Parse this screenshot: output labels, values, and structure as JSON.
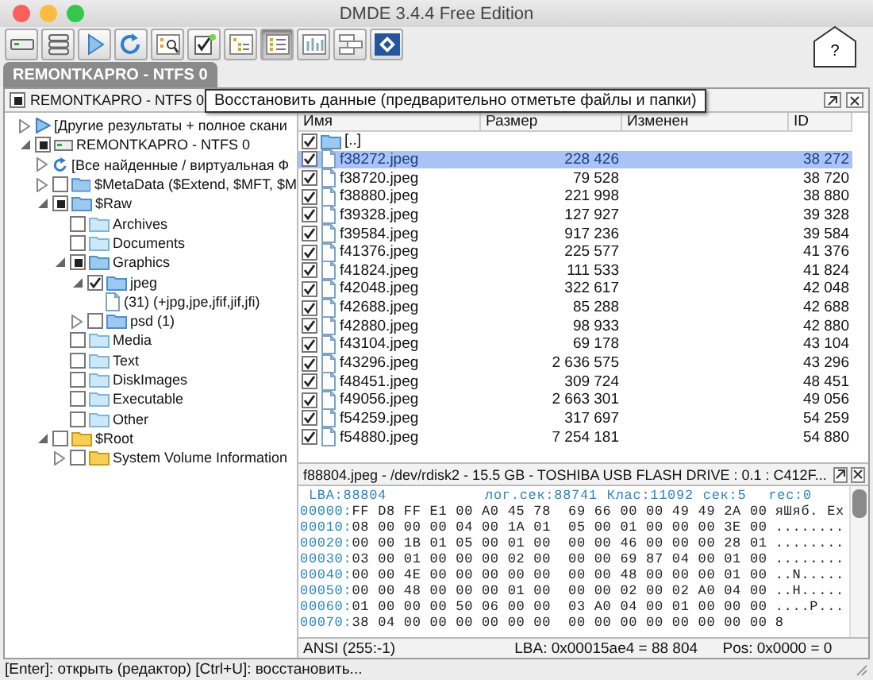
{
  "window": {
    "title": "DMDE 3.4.4 Free Edition"
  },
  "toolbar": [
    {
      "selected": false
    },
    {
      "selected": false
    },
    {
      "selected": false
    },
    {
      "selected": false
    },
    {
      "selected": false
    },
    {
      "selected": false
    },
    {
      "selected": false
    },
    {
      "selected": true
    },
    {
      "selected": false
    },
    {
      "selected": false
    },
    {
      "selected": false
    }
  ],
  "help_button": "?",
  "tabs": [
    {
      "label": "REMONTKAPRO - NTFS 0",
      "selected": true
    }
  ],
  "panel": {
    "title": "REMONTKAPRO - NTFS 0",
    "tooltip": "Восстановить данные (предварительно отметьте файлы и папки)"
  },
  "tree": [
    {
      "label": "[Другие результаты + полное скани",
      "kind": "play",
      "expanded": false
    },
    {
      "label": "REMONTKAPRO - NTFS 0",
      "kind": "drive",
      "expanded": true,
      "checked": false,
      "partial": true,
      "children": [
        {
          "label": "[Все найденные / виртуальная Ф",
          "kind": "refresh",
          "expanded": false
        },
        {
          "label": "$MetaData ($Extend, $MFT, $M",
          "kind": "folder",
          "expanded": false,
          "checked": false,
          "partial": false
        },
        {
          "label": "$Raw",
          "kind": "folder",
          "expanded": true,
          "checked": false,
          "partial": true,
          "children": [
            {
              "label": "Archives",
              "kind": "folder-light",
              "checked": false,
              "partial": false
            },
            {
              "label": "Documents",
              "kind": "folder-light",
              "checked": false,
              "partial": false
            },
            {
              "label": "Graphics",
              "kind": "folder",
              "expanded": true,
              "checked": false,
              "partial": true,
              "children": [
                {
                  "label": "jpeg",
                  "kind": "folder",
                  "expanded": true,
                  "checked": true,
                  "partial": false,
                  "children": [
                    {
                      "label": "(31) (+jpg,jpe,jfif,jif,jfi)",
                      "kind": "file"
                    }
                  ]
                },
                {
                  "label": "psd (1)",
                  "kind": "folder",
                  "expanded": false,
                  "checked": false,
                  "partial": false
                }
              ]
            },
            {
              "label": "Media",
              "kind": "folder-light",
              "checked": false,
              "partial": false
            },
            {
              "label": "Text",
              "kind": "folder-light",
              "checked": false,
              "partial": false
            },
            {
              "label": "DiskImages",
              "kind": "folder-light",
              "checked": false,
              "partial": false
            },
            {
              "label": "Executable",
              "kind": "folder-light",
              "checked": false,
              "partial": false
            },
            {
              "label": "Other",
              "kind": "folder-light",
              "checked": false,
              "partial": false
            }
          ]
        },
        {
          "label": "$Root",
          "kind": "folder-yellow",
          "expanded": true,
          "checked": false,
          "partial": false,
          "children": [
            {
              "label": "System Volume Information",
              "kind": "folder-yellow",
              "expanded": false,
              "checked": false,
              "partial": false
            }
          ]
        }
      ]
    }
  ],
  "table": {
    "columns": [
      "Имя",
      "Размер",
      "Изменен",
      "ID"
    ],
    "rows": [
      {
        "name": "[..]",
        "kind": "folder",
        "checked": true,
        "selected": false
      },
      {
        "name": "f38272.jpeg",
        "size": "228 426",
        "id": "38 272",
        "kind": "file",
        "checked": true,
        "selected": true
      },
      {
        "name": "f38720.jpeg",
        "size": "79 528",
        "id": "38 720",
        "kind": "file",
        "checked": true,
        "selected": false
      },
      {
        "name": "f38880.jpeg",
        "size": "221 998",
        "id": "38 880",
        "kind": "file",
        "checked": true,
        "selected": false
      },
      {
        "name": "f39328.jpeg",
        "size": "127 927",
        "id": "39 328",
        "kind": "file",
        "checked": true,
        "selected": false
      },
      {
        "name": "f39584.jpeg",
        "size": "917 236",
        "id": "39 584",
        "kind": "file",
        "checked": true,
        "selected": false
      },
      {
        "name": "f41376.jpeg",
        "size": "225 577",
        "id": "41 376",
        "kind": "file",
        "checked": true,
        "selected": false
      },
      {
        "name": "f41824.jpeg",
        "size": "111 533",
        "id": "41 824",
        "kind": "file",
        "checked": true,
        "selected": false
      },
      {
        "name": "f42048.jpeg",
        "size": "322 617",
        "id": "42 048",
        "kind": "file",
        "checked": true,
        "selected": false
      },
      {
        "name": "f42688.jpeg",
        "size": "85 288",
        "id": "42 688",
        "kind": "file",
        "checked": true,
        "selected": false
      },
      {
        "name": "f42880.jpeg",
        "size": "98 933",
        "id": "42 880",
        "kind": "file",
        "checked": true,
        "selected": false
      },
      {
        "name": "f43104.jpeg",
        "size": "69 178",
        "id": "43 104",
        "kind": "file",
        "checked": true,
        "selected": false
      },
      {
        "name": "f43296.jpeg",
        "size": "2 636 575",
        "id": "43 296",
        "kind": "file",
        "checked": true,
        "selected": false
      },
      {
        "name": "f48451.jpeg",
        "size": "309 724",
        "id": "48 451",
        "kind": "file",
        "checked": true,
        "selected": false
      },
      {
        "name": "f49056.jpeg",
        "size": "2 663 301",
        "id": "49 056",
        "kind": "file",
        "checked": true,
        "selected": false
      },
      {
        "name": "f54259.jpeg",
        "size": "317 697",
        "id": "54 259",
        "kind": "file",
        "checked": true,
        "selected": false
      },
      {
        "name": "f54880.jpeg",
        "size": "7 254 181",
        "id": "54 880",
        "kind": "file",
        "checked": true,
        "selected": false
      }
    ]
  },
  "hex": {
    "title": "f88804.jpeg - /dev/rdisk2 - 15.5 GB - TOSHIBA USB FLASH DRIVE : 0.1 : C412F...",
    "lba": "LBA:88804",
    "sector_info": [
      "лог.сек:88741",
      "Клас:11092",
      "сек:5",
      "rec:0"
    ],
    "lines": [
      {
        "offset": "00000:",
        "bytes": "FF D8 FF E1 00 A0 45 78  69 66 00 00 49 49 2A 00",
        "ascii": "яШяб. Ex"
      },
      {
        "offset": "00010:",
        "bytes": "08 00 00 00 04 00 1A 01  05 00 01 00 00 00 3E 00",
        "ascii": "........"
      },
      {
        "offset": "00020:",
        "bytes": "00 00 1B 01 05 00 01 00  00 00 46 00 00 00 28 01",
        "ascii": "........"
      },
      {
        "offset": "00030:",
        "bytes": "03 00 01 00 00 00 02 00  00 00 69 87 04 00 01 00",
        "ascii": "........"
      },
      {
        "offset": "00040:",
        "bytes": "00 00 4E 00 00 00 00 00  00 00 48 00 00 00 01 00",
        "ascii": "..N....."
      },
      {
        "offset": "00050:",
        "bytes": "00 00 48 00 00 00 01 00  00 00 02 00 02 A0 04 00",
        "ascii": "..H....."
      },
      {
        "offset": "00060:",
        "bytes": "01 00 00 00 50 06 00 00  03 A0 04 00 01 00 00 00",
        "ascii": "....P..."
      },
      {
        "offset": "00070:",
        "bytes": "38 04 00 00 00 00 00 00  00 00 00 00 00 00 00 00",
        "ascii": "8"
      }
    ],
    "status": [
      "ANSI (255:-1)",
      "LBA: 0x00015ae4 = 88 804",
      "Pos: 0x0000 = 0"
    ]
  },
  "status_bar": "[Enter]: открыть (редактор)  [Ctrl+U]: восстановить..."
}
